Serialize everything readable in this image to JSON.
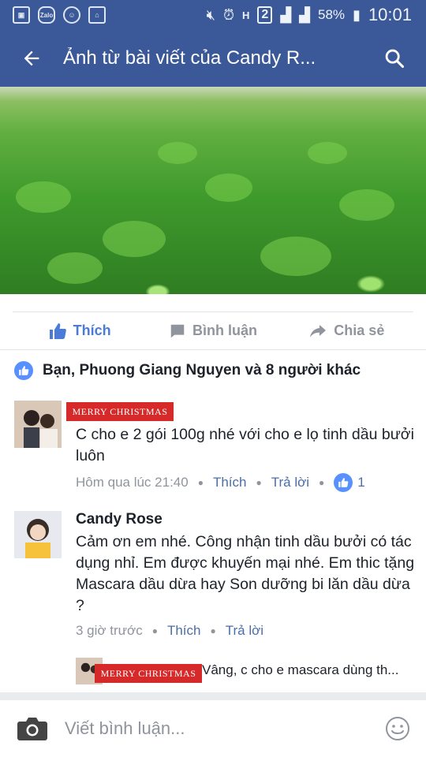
{
  "status_bar": {
    "battery": "58%",
    "time": "10:01",
    "sim": "2",
    "zalo": "Zalo"
  },
  "app_bar": {
    "title": "Ảnh từ bài viết của Candy R..."
  },
  "actions": {
    "like": "Thích",
    "comment": "Bình luận",
    "share": "Chia sẻ"
  },
  "reactions": {
    "summary": "Bạn, Phuong Giang Nguyen và 8 người khác"
  },
  "comments": [
    {
      "badge": "MERRY CHRISTMAS",
      "text": "C cho e 2 gói 100g nhé với cho e lọ tinh dầu bưởi luôn",
      "time": "Hôm qua lúc 21:40",
      "like": "Thích",
      "reply": "Trả lời",
      "like_count": "1"
    },
    {
      "name": "Candy Rose",
      "text": "Cảm ơn em nhé. Công nhận tinh dầu bưởi có tác dụng nhỉ. Em được khuyến mại nhé. Em thic tặng Mascara dầu dừa hay Son dưỡng bi lăn dầu dừa ?",
      "time": "3 giờ trước",
      "like": "Thích",
      "reply": "Trả lời"
    }
  ],
  "reply_preview": {
    "badge": "MERRY CHRISTMAS",
    "text": "Vâng, c cho e mascara dùng th..."
  },
  "composer": {
    "placeholder": "Viết bình luận..."
  },
  "colors": {
    "brand": "#3b5998",
    "like_blue": "#5890ff",
    "meta_gray": "#90949c"
  }
}
